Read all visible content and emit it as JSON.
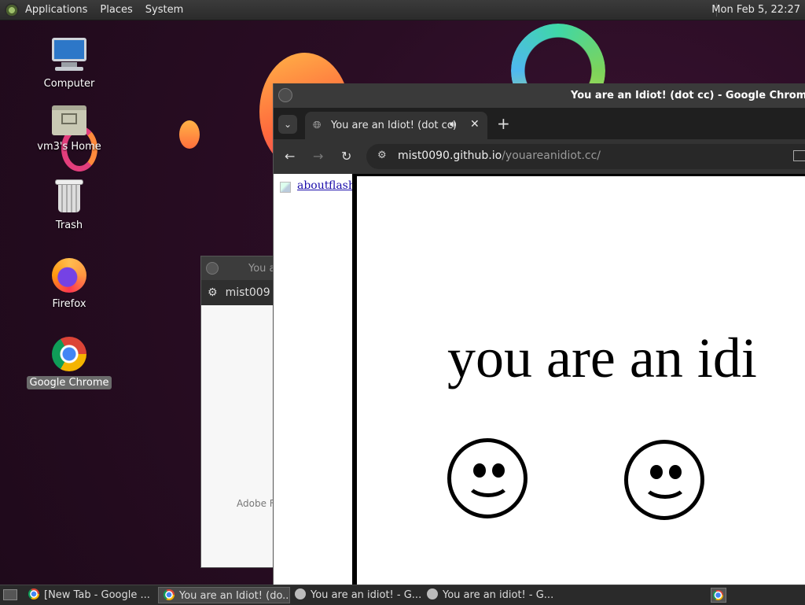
{
  "top_panel": {
    "menus": [
      "Applications",
      "Places",
      "System"
    ],
    "clock": "Mon Feb  5, 22:27"
  },
  "desktop_icons": [
    {
      "label": "Computer",
      "icon": "computer-icon"
    },
    {
      "label": "vm3's Home",
      "icon": "home-folder-icon"
    },
    {
      "label": "Trash",
      "icon": "trash-icon"
    },
    {
      "label": "Firefox",
      "icon": "firefox-icon"
    },
    {
      "label": "Google Chrome",
      "icon": "chrome-icon",
      "selected": true
    }
  ],
  "back_window": {
    "title": "You a",
    "address": "mist009",
    "body_text": "Adobe F"
  },
  "main_window": {
    "title": "You are an Idiot! (dot cc) - Google Chrome",
    "tab": {
      "title": "You are an Idiot! (dot cc)",
      "audio_icon": "speaker-icon",
      "close": "✕"
    },
    "new_tab": "+",
    "nav": {
      "back": "←",
      "forward": "→",
      "reload": "↻"
    },
    "url": {
      "domain": "mist0090.github.io",
      "path": "/youareanidiot.cc/"
    },
    "left_links": [
      "about",
      "flash"
    ],
    "headline": "you are an idi"
  },
  "taskbar": {
    "tasks": [
      {
        "label": "[New Tab - Google ...",
        "icon": "chrome-icon",
        "active": false
      },
      {
        "label": "You are an Idiot! (do...",
        "icon": "chrome-icon",
        "active": true
      },
      {
        "label": "You are an idiot! - G...",
        "icon": "globe-icon",
        "active": false
      },
      {
        "label": "You are an idiot! - G...",
        "icon": "globe-icon",
        "active": false
      }
    ]
  },
  "colors": {
    "panel": "#2b2b2b",
    "wallpaper": "#2a0d24",
    "link": "#1a0dab"
  }
}
